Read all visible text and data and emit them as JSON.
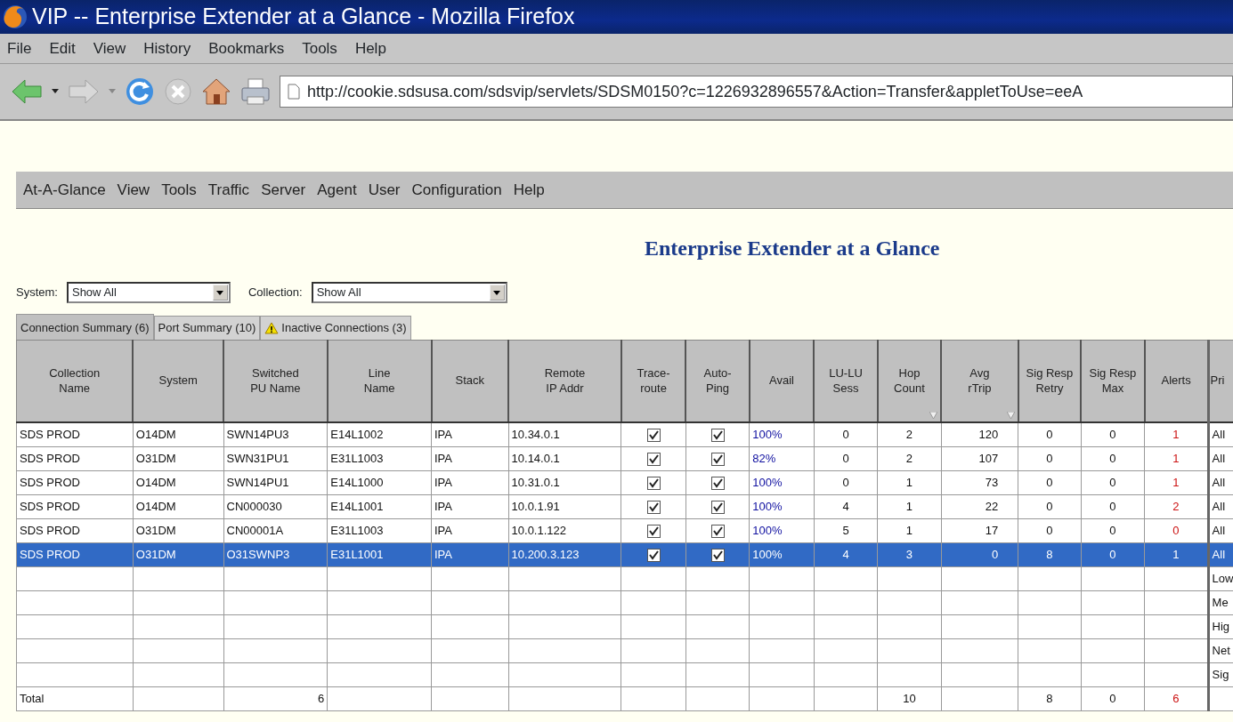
{
  "window": {
    "title": "VIP -- Enterprise Extender at a Glance - Mozilla Firefox"
  },
  "browser_menu": [
    "File",
    "Edit",
    "View",
    "History",
    "Bookmarks",
    "Tools",
    "Help"
  ],
  "address_bar": {
    "value": "http://cookie.sdsusa.com/sdsvip/servlets/SDSM0150?c=1226932896557&Action=Transfer&appletToUse=eeA"
  },
  "app_menu": [
    "At-A-Glance",
    "View",
    "Tools",
    "Traffic",
    "Server",
    "Agent",
    "User",
    "Configuration",
    "Help"
  ],
  "page_title": "Enterprise Extender at a Glance",
  "filters": [
    {
      "label": "System:",
      "value": "Show All"
    },
    {
      "label": "Collection:",
      "value": "Show All"
    }
  ],
  "tabs": [
    {
      "label": "Connection Summary (6)",
      "selected": true,
      "warning": false
    },
    {
      "label": "Port Summary (10)",
      "selected": false,
      "warning": false
    },
    {
      "label": "Inactive Connections (3)",
      "selected": false,
      "warning": true
    }
  ],
  "table": {
    "columns": [
      {
        "label": "Collection\nName",
        "sorted": false
      },
      {
        "label": "System",
        "sorted": false
      },
      {
        "label": "Switched\nPU Name",
        "sorted": false
      },
      {
        "label": "Line\nName",
        "sorted": false
      },
      {
        "label": "Stack",
        "sorted": false
      },
      {
        "label": "Remote\nIP Addr",
        "sorted": false
      },
      {
        "label": "Trace-\nroute",
        "sorted": false
      },
      {
        "label": "Auto-\nPing",
        "sorted": false
      },
      {
        "label": "Avail",
        "sorted": false
      },
      {
        "label": "LU-LU\nSess",
        "sorted": false
      },
      {
        "label": "Hop\nCount",
        "sorted": true
      },
      {
        "label": "Avg\nrTrip",
        "sorted": true
      },
      {
        "label": "Sig Resp\nRetry",
        "sorted": false
      },
      {
        "label": "Sig Resp\nMax",
        "sorted": false
      },
      {
        "label": "Alerts",
        "sorted": false
      },
      {
        "label": "Pri"
      }
    ],
    "rows": [
      {
        "selected": false,
        "collection": "SDS PROD",
        "system": "O14DM",
        "pu": "SWN14PU3",
        "line": "E14L1002",
        "stack": "IPA",
        "ip": "10.34.0.1",
        "traceroute": true,
        "autoping": true,
        "avail": "100%",
        "sess": "0",
        "hops": "2",
        "rtrip": "120",
        "retry": "0",
        "max": "0",
        "alerts": "1",
        "priority": "All"
      },
      {
        "selected": false,
        "collection": "SDS PROD",
        "system": "O31DM",
        "pu": "SWN31PU1",
        "line": "E31L1003",
        "stack": "IPA",
        "ip": "10.14.0.1",
        "traceroute": true,
        "autoping": true,
        "avail": "82%",
        "sess": "0",
        "hops": "2",
        "rtrip": "107",
        "retry": "0",
        "max": "0",
        "alerts": "1",
        "priority": "All"
      },
      {
        "selected": false,
        "collection": "SDS PROD",
        "system": "O14DM",
        "pu": "SWN14PU1",
        "line": "E14L1000",
        "stack": "IPA",
        "ip": "10.31.0.1",
        "traceroute": true,
        "autoping": true,
        "avail": "100%",
        "sess": "0",
        "hops": "1",
        "rtrip": "73",
        "retry": "0",
        "max": "0",
        "alerts": "1",
        "priority": "All"
      },
      {
        "selected": false,
        "collection": "SDS PROD",
        "system": "O14DM",
        "pu": "CN000030",
        "line": "E14L1001",
        "stack": "IPA",
        "ip": "10.0.1.91",
        "traceroute": true,
        "autoping": true,
        "avail": "100%",
        "sess": "4",
        "hops": "1",
        "rtrip": "22",
        "retry": "0",
        "max": "0",
        "alerts": "2",
        "priority": "All"
      },
      {
        "selected": false,
        "collection": "SDS PROD",
        "system": "O31DM",
        "pu": "CN00001A",
        "line": "E31L1003",
        "stack": "IPA",
        "ip": "10.0.1.122",
        "traceroute": true,
        "autoping": true,
        "avail": "100%",
        "sess": "5",
        "hops": "1",
        "rtrip": "17",
        "retry": "0",
        "max": "0",
        "alerts": "0",
        "priority": "All"
      },
      {
        "selected": true,
        "collection": "SDS PROD",
        "system": "O31DM",
        "pu": "O31SWNP3",
        "line": "E31L1001",
        "stack": "IPA",
        "ip": "10.200.3.123",
        "traceroute": true,
        "autoping": true,
        "avail": "100%",
        "sess": "4",
        "hops": "3",
        "rtrip": "0",
        "retry": "8",
        "max": "0",
        "alerts": "1",
        "priority": "All"
      },
      {
        "selected": false,
        "priority": "Low"
      },
      {
        "selected": false,
        "priority": "Me"
      },
      {
        "selected": false,
        "priority": "Hig"
      },
      {
        "selected": false,
        "priority": "Net"
      },
      {
        "selected": false,
        "priority": "Sig"
      }
    ],
    "total": {
      "label": "Total",
      "pu": "6",
      "hops": "10",
      "retry": "8",
      "max": "0",
      "alerts": "6"
    }
  }
}
